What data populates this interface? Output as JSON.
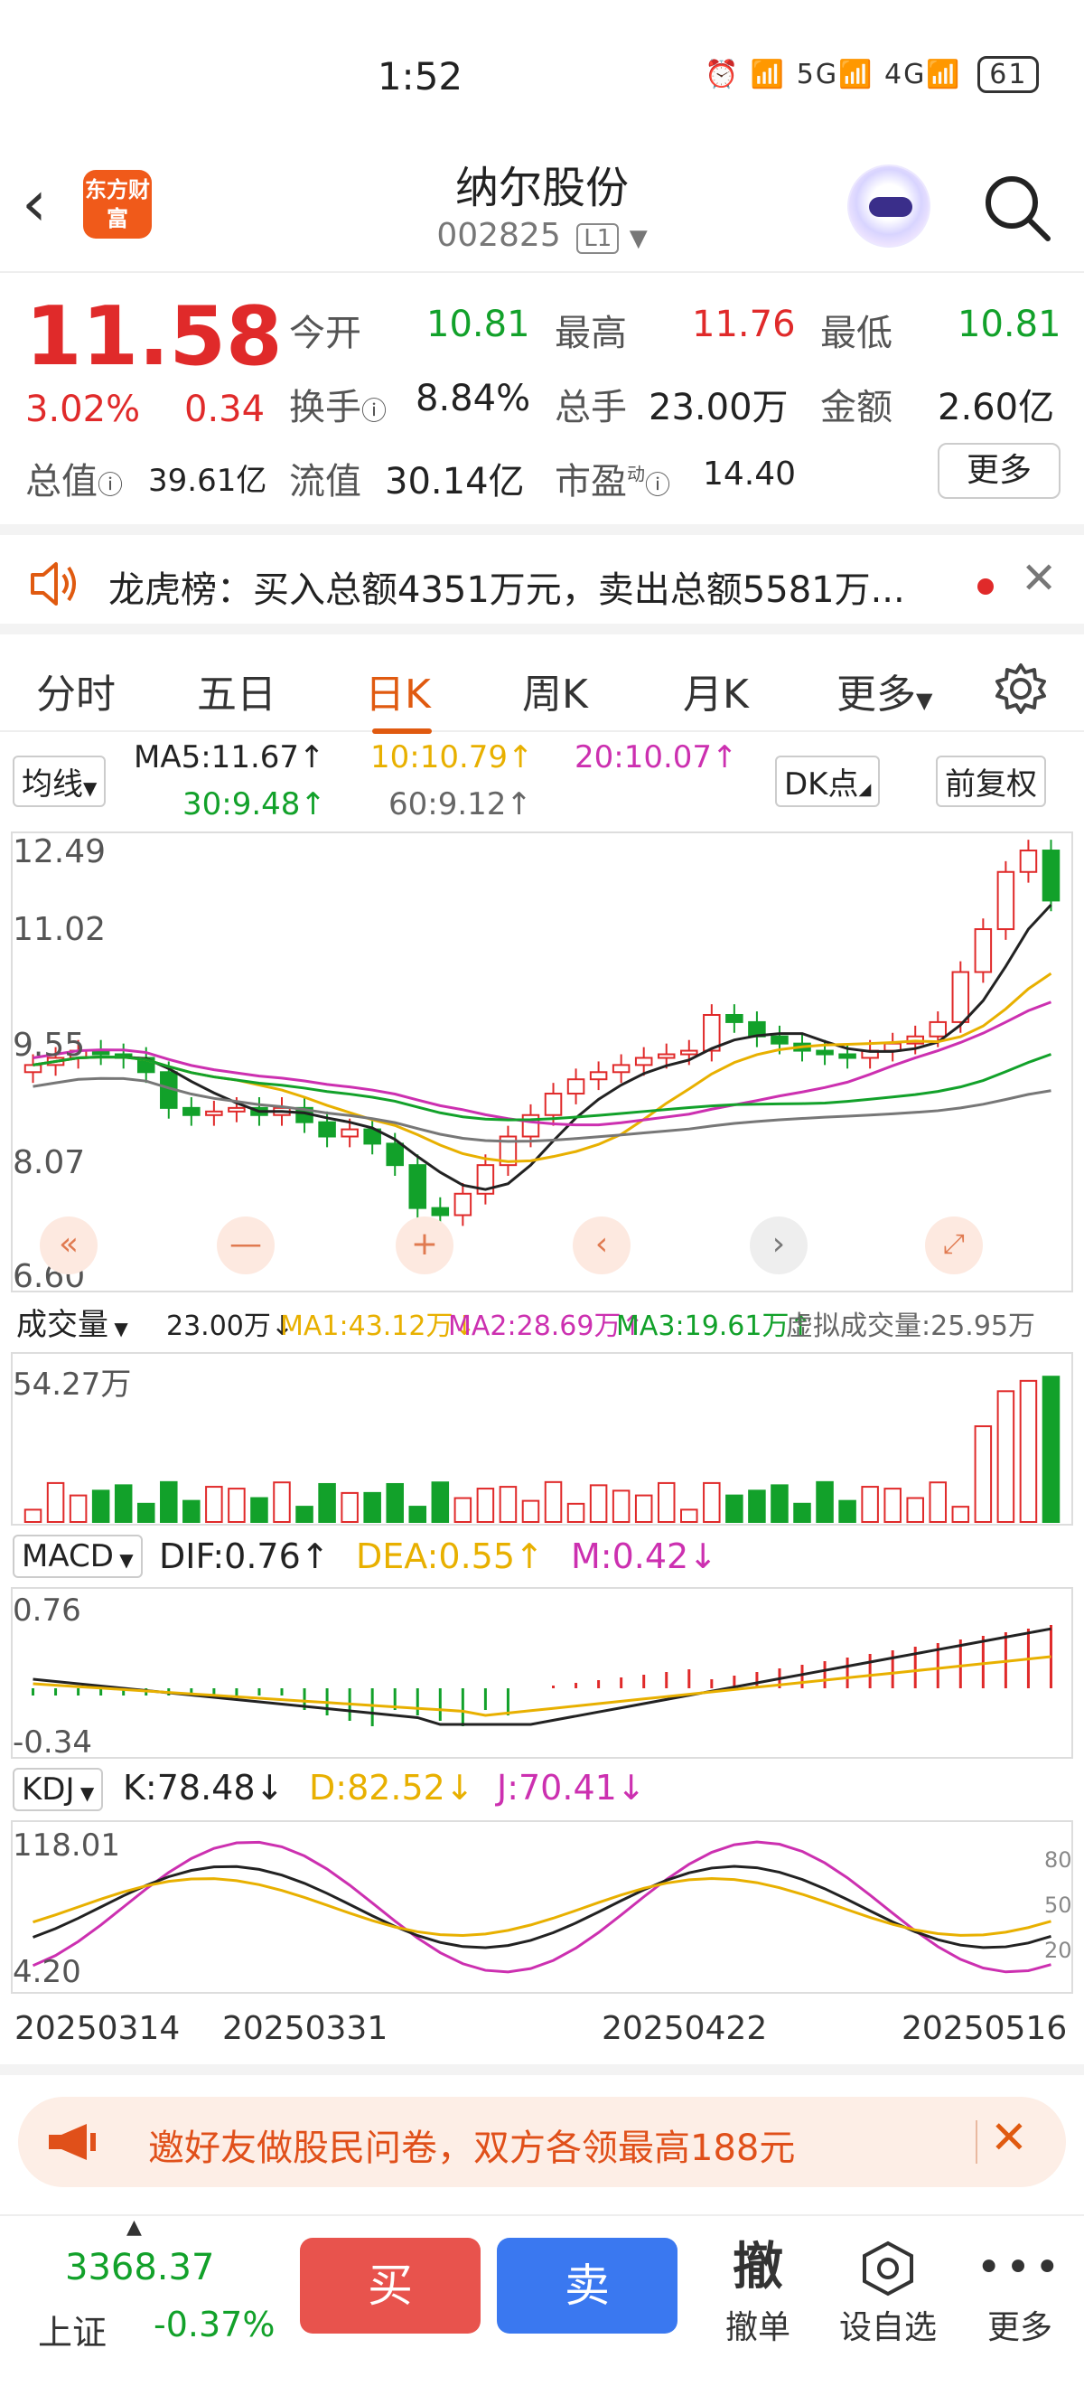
{
  "status": {
    "time": "1:52",
    "signals": "⏰ 📶 5G📶 4G📶",
    "battery": "61"
  },
  "header": {
    "name": "纳尔股份",
    "code": "002825",
    "level": "L1",
    "logo": "东方财富"
  },
  "quote": {
    "price": "11.58",
    "pct": "3.02%",
    "chg": "0.34",
    "open_label": "今开",
    "open": "10.81",
    "high_label": "最高",
    "high": "11.76",
    "low_label": "最低",
    "low": "10.81",
    "turnover_label": "换手",
    "turnover": "8.84%",
    "vol_label": "总手",
    "vol": "23.00万",
    "amount_label": "金额",
    "amount": "2.60亿",
    "mcap_label": "总值",
    "mcap": "39.61亿",
    "float_label": "流值",
    "float": "30.14亿",
    "pe_label": "市盈",
    "pe_sup": "动",
    "pe": "14.40",
    "more": "更多"
  },
  "notice": {
    "text": "龙虎榜：买入总额4351万元，卖出总额5581万..."
  },
  "tabs": [
    "分时",
    "五日",
    "日K",
    "周K",
    "月K",
    "更多"
  ],
  "active_tab": "日K",
  "kline": {
    "ma_chip": "均线",
    "ma5": "MA5:11.67↑",
    "ma10": "10:10.79↑",
    "ma20": "20:10.07↑",
    "ma30": "30:9.48↑",
    "ma60": "60:9.12↑",
    "dk": "DK点",
    "adj": "前复权",
    "y_labels": [
      "12.49",
      "11.02",
      "9.55",
      "8.07",
      "6.60"
    ]
  },
  "volume": {
    "chip": "成交量",
    "vol": "23.00万↓",
    "ma1": "MA1:43.12万↓",
    "ma2": "MA2:28.69万↑",
    "ma3": "MA3:19.61万↑",
    "virtual": "虚拟成交量:25.95万",
    "max": "54.27万"
  },
  "macd": {
    "chip": "MACD",
    "dif": "DIF:0.76↑",
    "dea": "DEA:0.55↑",
    "m": "M:0.42↓",
    "top": "0.76",
    "bottom": "-0.34"
  },
  "kdj": {
    "chip": "KDJ",
    "k": "K:78.48↓",
    "d": "D:82.52↓",
    "j": "J:70.41↓",
    "top": "118.01",
    "bottom": "4.20",
    "levels": [
      "80",
      "50",
      "20"
    ]
  },
  "dates": [
    "20250314",
    "20250331",
    "20250422",
    "20250516"
  ],
  "banner": {
    "text": "邀好友做股民问卷，双方各领最高188元"
  },
  "footer": {
    "index_value": "3368.37",
    "index_name": "上证",
    "index_chg": "-0.37%",
    "buy": "买",
    "sell": "卖",
    "cancel_icon": "撤",
    "cancel": "撤单",
    "watch": "设自选",
    "more": "更多"
  },
  "colors": {
    "up": "#e02a2a",
    "down": "#12a12a",
    "accent": "#e05a10"
  }
}
